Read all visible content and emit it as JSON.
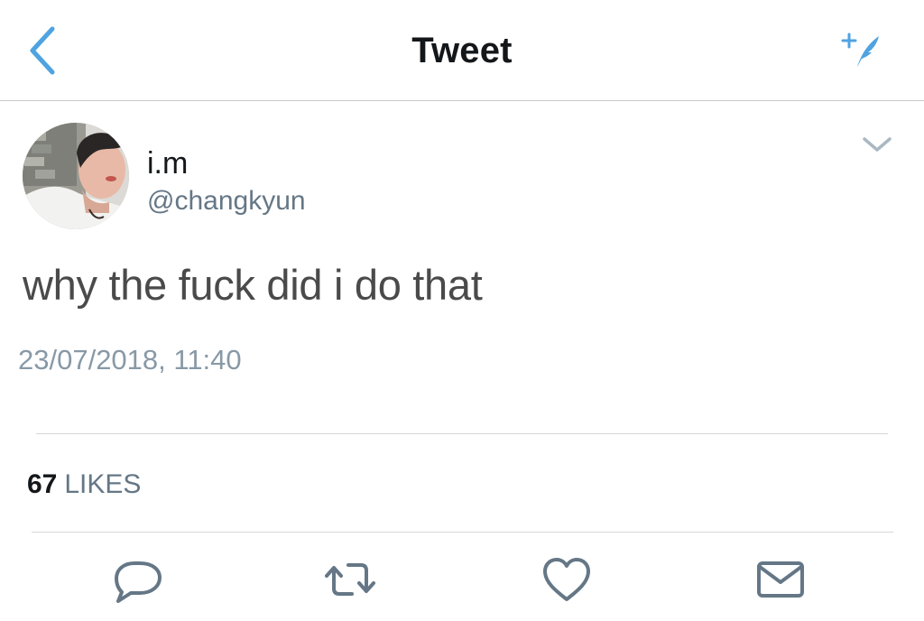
{
  "header": {
    "title": "Tweet",
    "back_icon": "chevron-left-icon",
    "compose_icon": "feather-compose-icon",
    "accent_color": "#4fa3e0"
  },
  "tweet": {
    "author": {
      "display_name": "i.m",
      "handle": "@changkyun",
      "avatar": "profile-photo"
    },
    "text": "why the fuck did i do that",
    "timestamp": "23/07/2018, 11:40",
    "menu_icon": "chevron-down-icon"
  },
  "stats": {
    "likes_count": "67",
    "likes_label": "LIKES"
  },
  "actions": {
    "reply_icon": "speech-bubble-icon",
    "retweet_icon": "retweet-icon",
    "like_icon": "heart-icon",
    "dm_icon": "envelope-icon",
    "icon_color": "#657786"
  }
}
